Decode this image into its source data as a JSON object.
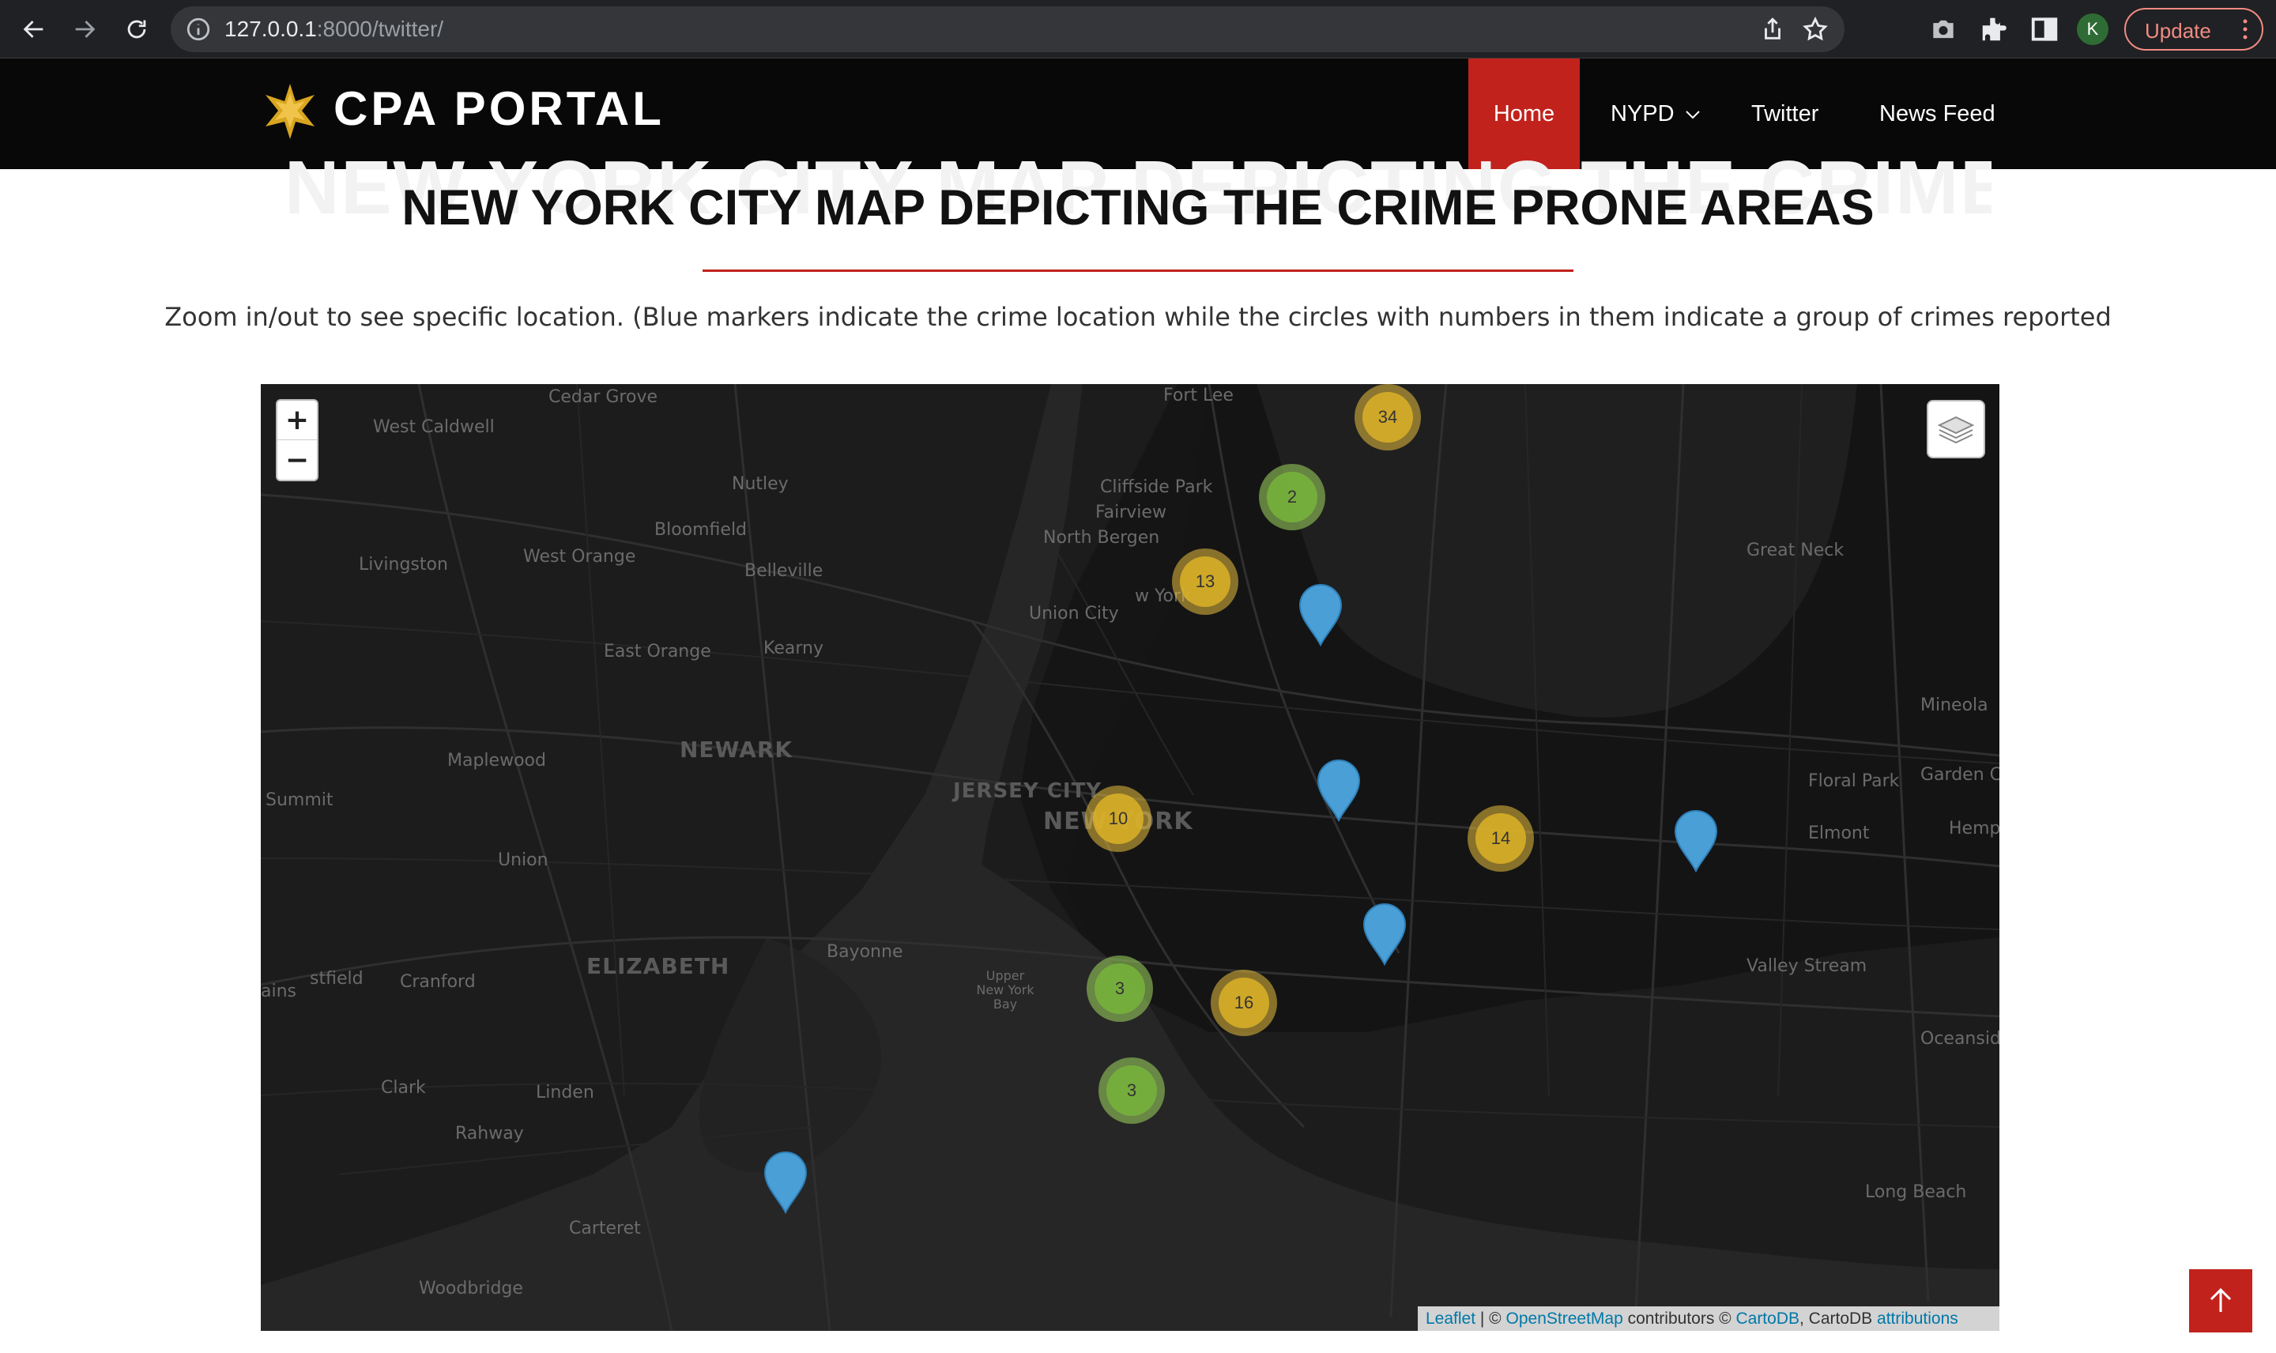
{
  "browser": {
    "url_host": "127.0.0.1",
    "url_path": ":8000/twitter/",
    "update_label": "Update",
    "profile_initial": "K"
  },
  "site": {
    "brand": "CPA PORTAL",
    "nav": {
      "home": "Home",
      "nypd": "NYPD",
      "twitter": "Twitter",
      "news_feed": "News Feed"
    },
    "accent_color": "#c2221c"
  },
  "page": {
    "title": "NEW YORK CITY MAP DEPICTING THE CRIME PRONE AREAS",
    "intro": "Zoom in/out to see specific location. (Blue markers indicate the crime location while the circles with numbers in them indicate a group of crimes reported"
  },
  "map": {
    "zoom_in": "+",
    "zoom_out": "−",
    "places": [
      "Cedar Grove",
      "West Caldwell",
      "Nutley",
      "Bloomfield",
      "Livingston",
      "West Orange",
      "Belleville",
      "East Orange",
      "Kearny",
      "Maplewood",
      "NEWARK",
      "Summit",
      "Union",
      "ELIZABETH",
      "Cranford",
      "stfield",
      "ains",
      "Clark",
      "Linden",
      "Rahway",
      "Carteret",
      "Woodbridge",
      "Bayonne",
      "Upper New York Bay",
      "JERSEY CITY",
      "NEW YORK",
      "Union City",
      "North Bergen",
      "Cliffside Park",
      "Fairview",
      "Fort Lee",
      "Great Neck",
      "Mineola",
      "Garden C",
      "Floral Park",
      "Hemp",
      "Elmont",
      "Valley Stream",
      "Oceanside",
      "Long Beach",
      "w York"
    ],
    "clusters": [
      {
        "count": "34",
        "tier": "medium"
      },
      {
        "count": "2",
        "tier": "small"
      },
      {
        "count": "13",
        "tier": "medium"
      },
      {
        "count": "10",
        "tier": "medium"
      },
      {
        "count": "14",
        "tier": "medium"
      },
      {
        "count": "3",
        "tier": "small"
      },
      {
        "count": "16",
        "tier": "medium"
      },
      {
        "count": "3",
        "tier": "small"
      }
    ],
    "marker_color": "#4a9fd6",
    "attribution": {
      "leaflet": "Leaflet",
      "sep1": " | © ",
      "osm": "OpenStreetMap",
      "mid": " contributors © ",
      "cartodb": "CartoDB",
      "mid2": ", CartoDB ",
      "attributions": "attributions"
    }
  }
}
